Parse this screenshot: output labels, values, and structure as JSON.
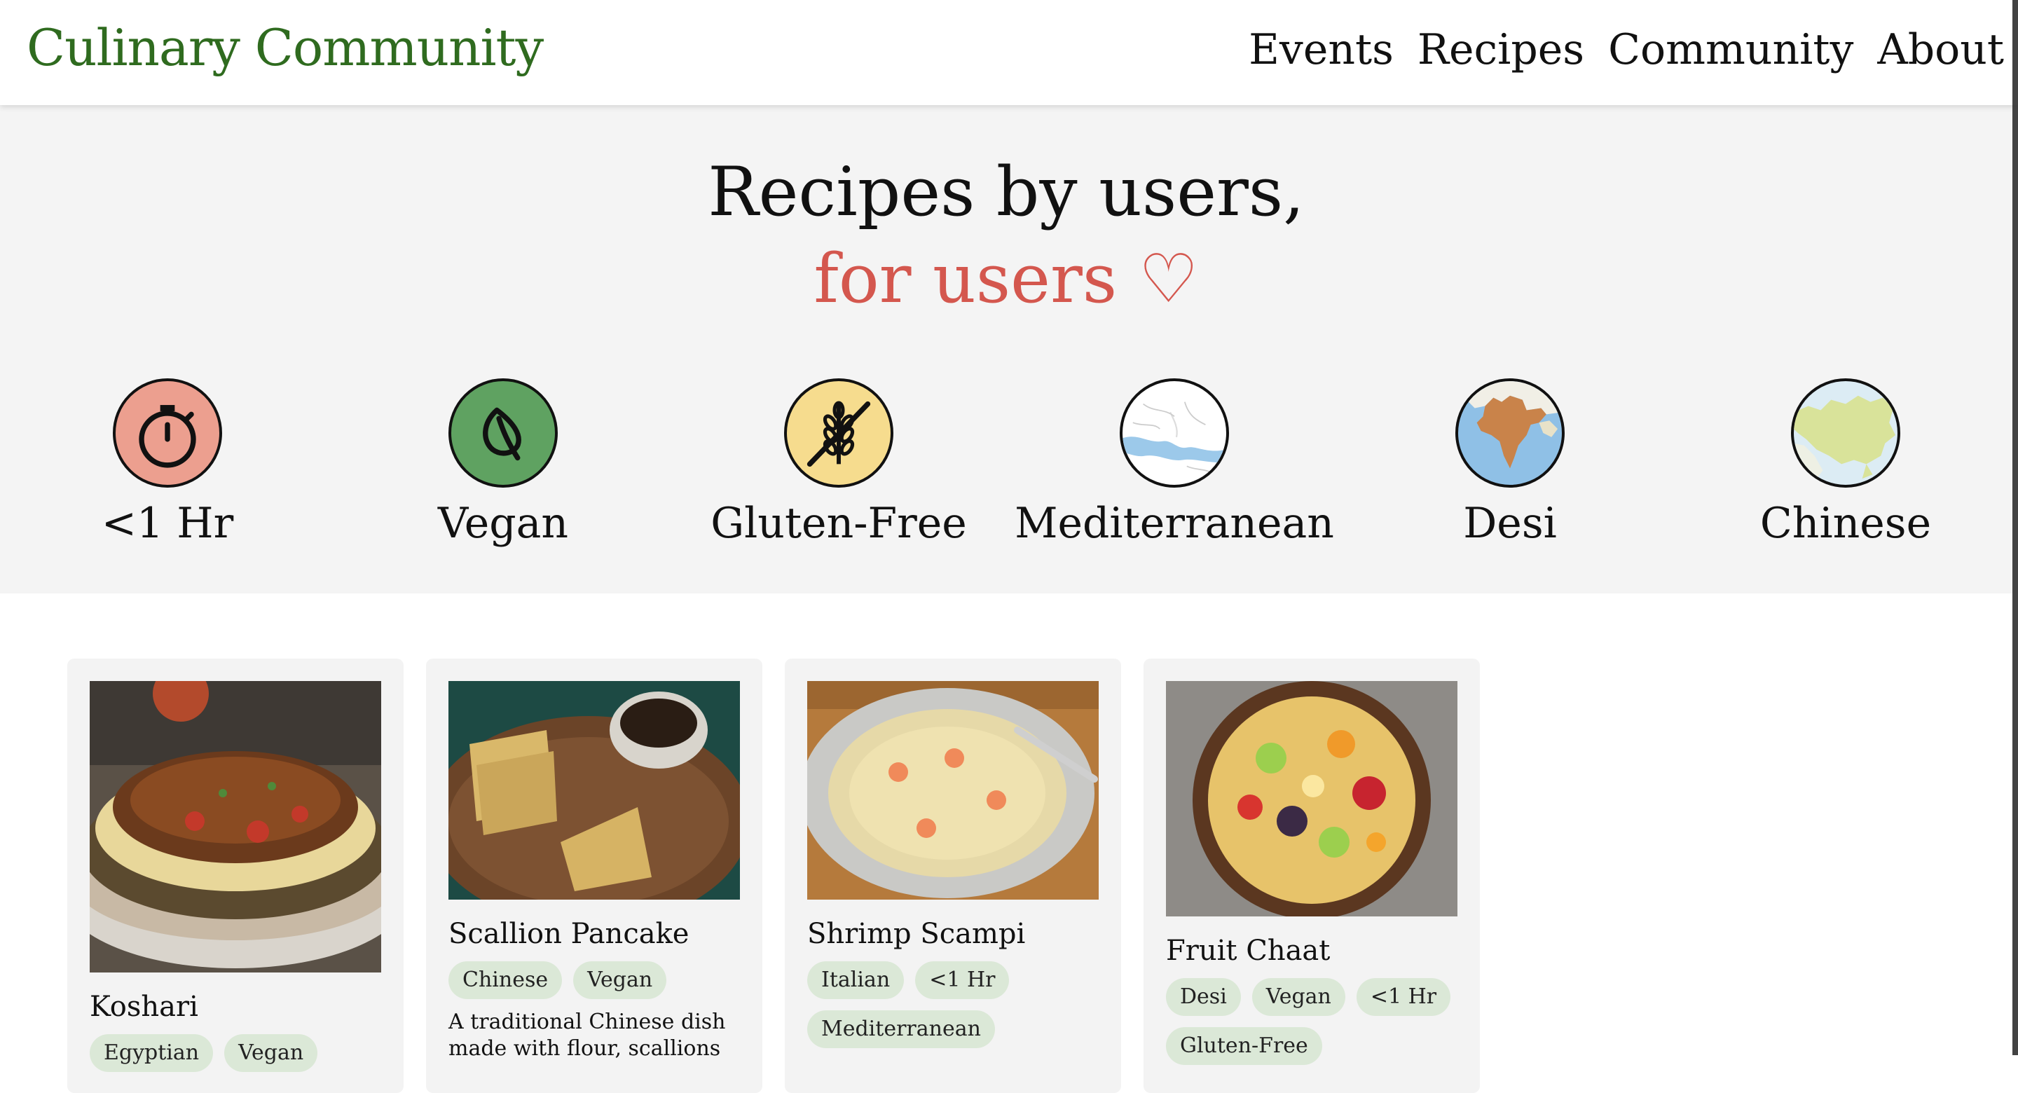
{
  "header": {
    "brand": "Culinary Community",
    "nav": [
      "Events",
      "Recipes",
      "Community",
      "About"
    ]
  },
  "hero": {
    "title_line1": "Recipes by users,",
    "title_line2": "for users ♡"
  },
  "categories": [
    {
      "label": "<1 Hr",
      "icon": "stopwatch-icon",
      "color": "#ec9f8f"
    },
    {
      "label": "Vegan",
      "icon": "leaf-icon",
      "color": "#5fa261"
    },
    {
      "label": "Gluten-Free",
      "icon": "no-wheat-icon",
      "color": "#f6dc8e"
    },
    {
      "label": "Mediterranean",
      "icon": "mediterranean-map-icon",
      "color": "#9cc9ea"
    },
    {
      "label": "Desi",
      "icon": "south-asia-map-icon",
      "color": "#c9834a"
    },
    {
      "label": "Chinese",
      "icon": "china-map-icon",
      "color": "#d9e39a"
    }
  ],
  "recipes": [
    {
      "title": "Koshari",
      "tags": [
        "Egyptian",
        "Vegan"
      ],
      "description": ""
    },
    {
      "title": "Scallion Pancake",
      "tags": [
        "Chinese",
        "Vegan"
      ],
      "description": "A traditional Chinese dish made with flour, scallions"
    },
    {
      "title": "Shrimp Scampi",
      "tags": [
        "Italian",
        "<1 Hr",
        "Mediterranean"
      ],
      "description": ""
    },
    {
      "title": "Fruit Chaat",
      "tags": [
        "Desi",
        "Vegan",
        "<1 Hr",
        "Gluten-Free"
      ],
      "description": ""
    }
  ]
}
